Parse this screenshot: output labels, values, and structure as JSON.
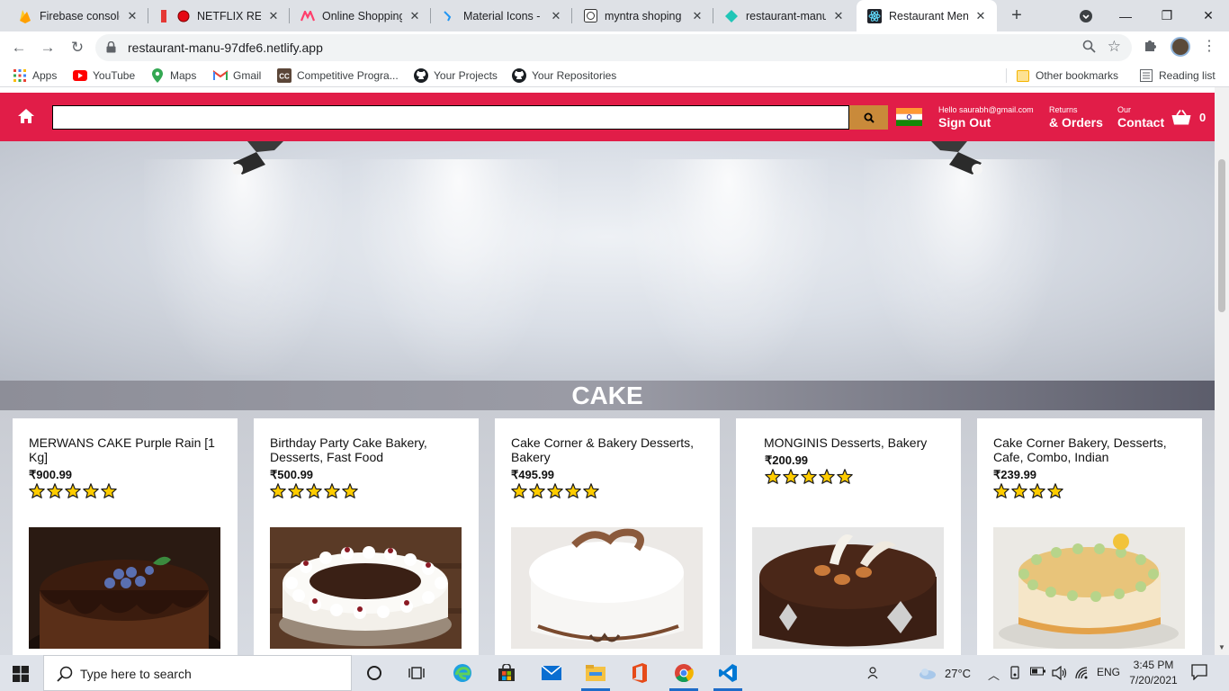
{
  "browser": {
    "tabs": [
      {
        "title": "Firebase console",
        "icon": "firebase-icon"
      },
      {
        "title": "NETFLIX REAC",
        "icon": "netflix-icon"
      },
      {
        "title": "Online Shopping",
        "icon": "myntra-icon"
      },
      {
        "title": "Material Icons - N",
        "icon": "material-icons-icon"
      },
      {
        "title": "myntra shoping s",
        "icon": "codesandbox-icon"
      },
      {
        "title": "restaurant-manu-",
        "icon": "netlify-icon"
      },
      {
        "title": "Restaurant Menu",
        "icon": "react-icon",
        "active": true
      }
    ],
    "new_tab": "+",
    "url": "restaurant-manu-97dfe6.netlify.app",
    "bookmarks": [
      {
        "label": "Apps",
        "icon": "apps-grid-icon"
      },
      {
        "label": "YouTube",
        "icon": "youtube-icon"
      },
      {
        "label": "Maps",
        "icon": "maps-icon"
      },
      {
        "label": "Gmail",
        "icon": "gmail-icon"
      },
      {
        "label": "Competitive Progra...",
        "icon": "cc-icon"
      },
      {
        "label": "Your Projects",
        "icon": "github-icon"
      },
      {
        "label": "Your Repositories",
        "icon": "github-icon"
      }
    ],
    "other_bookmarks": "Other bookmarks",
    "reading_list": "Reading list"
  },
  "site": {
    "header": {
      "search_value": "",
      "greeting": "Hello saurabh@gmail.com",
      "sign_out": "Sign Out",
      "returns_small": "Returns",
      "returns_big": "& Orders",
      "contact_small": "Our",
      "contact_big": "Contact",
      "cart_count": "0",
      "brand_color": "#e11d48",
      "search_button_color": "#c98a3a"
    },
    "section_title": "CAKE",
    "products": [
      {
        "name": "MERWANS CAKE Purple Rain [1 Kg]",
        "price": "₹900.99",
        "rating": 5
      },
      {
        "name": "Birthday Party Cake Bakery, Desserts, Fast Food",
        "price": "₹500.99",
        "rating": 5
      },
      {
        "name": "Cake Corner & Bakery Desserts, Bakery",
        "price": "₹495.99",
        "rating": 5
      },
      {
        "name": "MONGINIS Desserts, Bakery",
        "price": "₹200.99",
        "rating": 5
      },
      {
        "name": "Cake Corner Bakery, Desserts, Cafe, Combo, Indian",
        "price": "₹239.99",
        "rating": 4
      }
    ]
  },
  "taskbar": {
    "search_placeholder": "Type here to search",
    "weather": "27°C",
    "language": "ENG",
    "time": "3:45 PM",
    "date": "7/20/2021"
  }
}
